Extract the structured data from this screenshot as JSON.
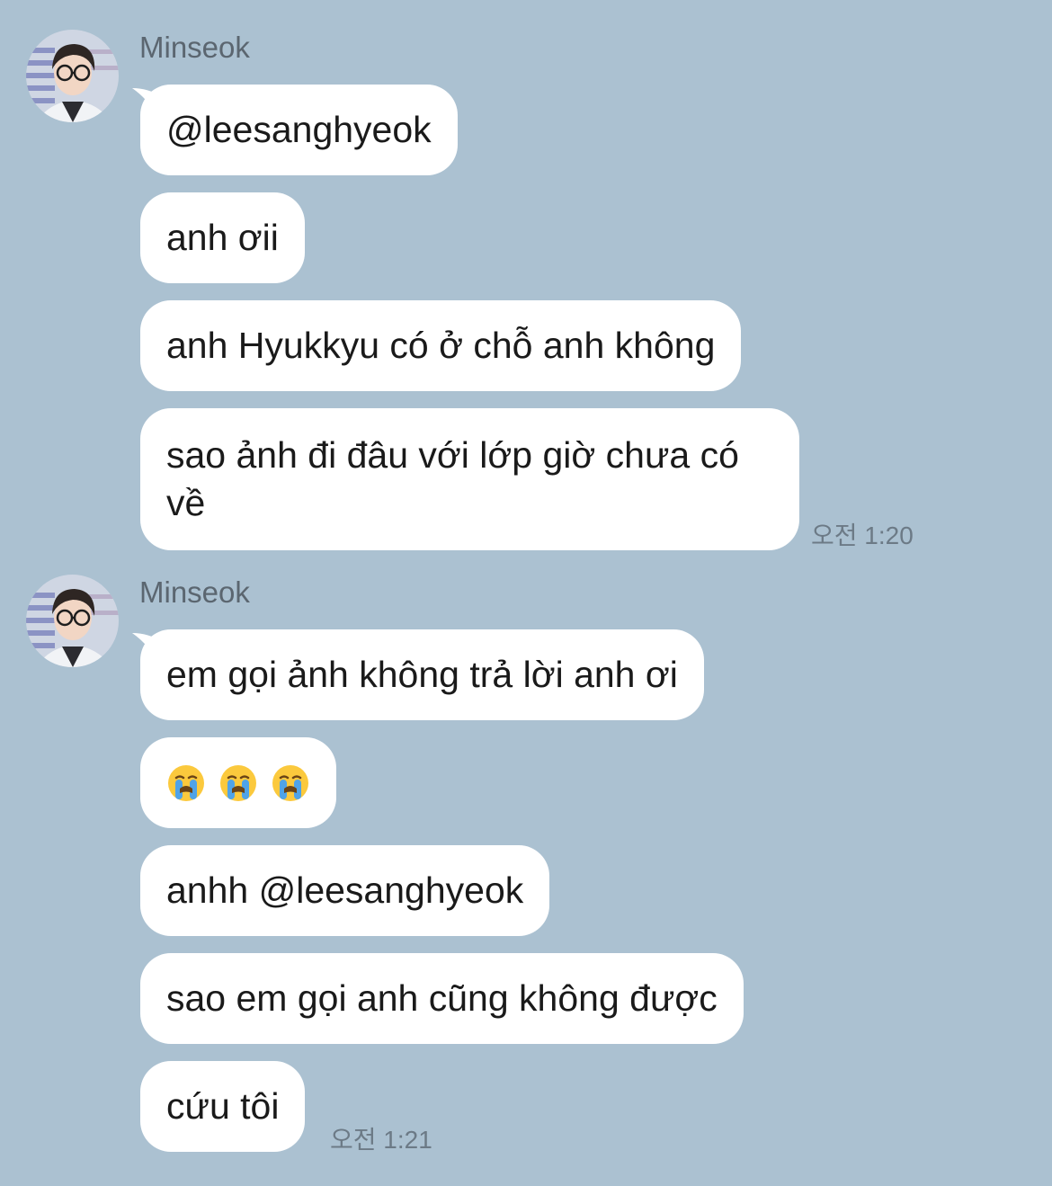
{
  "chat": {
    "groups": [
      {
        "sender": "Minseok",
        "time": "오전 1:20",
        "messages": [
          "@leesanghyeok",
          "anh ơii",
          "anh Hyukkyu có ở chỗ anh không",
          "sao ảnh đi đâu với lớp giờ chưa có về"
        ]
      },
      {
        "sender": "Minseok",
        "time": "오전 1:21",
        "messages": [
          "em gọi ảnh không trả lời anh ơi",
          "😭😭😭",
          "anhh @leesanghyeok",
          "sao em gọi anh cũng không được",
          "cứu tôi"
        ]
      }
    ]
  },
  "icons": {
    "avatar": "profile-photo-icon",
    "crying_emoji": "loudly-crying-face-icon"
  },
  "colors": {
    "background": "#abc1d1",
    "bubble": "#ffffff",
    "sender_name": "#5b6670",
    "timestamp": "#6c7a86"
  }
}
